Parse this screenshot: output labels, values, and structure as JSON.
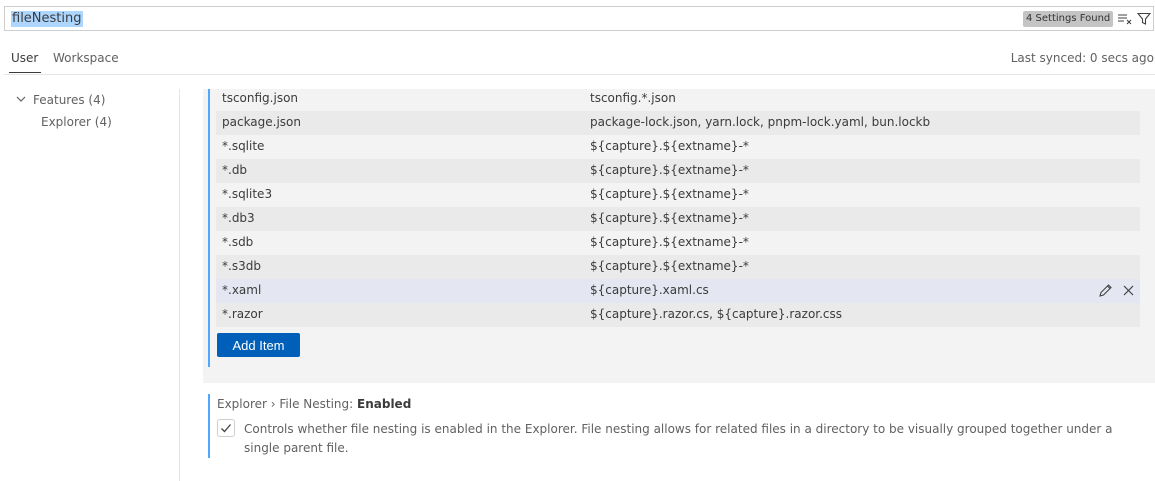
{
  "search": {
    "value": "fileNesting",
    "results_badge": "4 Settings Found"
  },
  "tabs": {
    "user": "User",
    "workspace": "Workspace",
    "last_synced": "Last synced: 0 secs ago"
  },
  "toc": {
    "features": "Features (4)",
    "explorer": "Explorer (4)"
  },
  "patterns": [
    {
      "key": "tsconfig.json",
      "value": "tsconfig.*.json"
    },
    {
      "key": "package.json",
      "value": "package-lock.json, yarn.lock, pnpm-lock.yaml, bun.lockb"
    },
    {
      "key": "*.sqlite",
      "value": "${capture}.${extname}-*"
    },
    {
      "key": "*.db",
      "value": "${capture}.${extname}-*"
    },
    {
      "key": "*.sqlite3",
      "value": "${capture}.${extname}-*"
    },
    {
      "key": "*.db3",
      "value": "${capture}.${extname}-*"
    },
    {
      "key": "*.sdb",
      "value": "${capture}.${extname}-*"
    },
    {
      "key": "*.s3db",
      "value": "${capture}.${extname}-*"
    },
    {
      "key": "*.xaml",
      "value": "${capture}.xaml.cs"
    },
    {
      "key": "*.razor",
      "value": "${capture}.razor.cs, ${capture}.razor.css"
    }
  ],
  "add_item_label": "Add Item",
  "enabled_setting": {
    "category": "Explorer › File Nesting: ",
    "name": "Enabled",
    "checked": true,
    "description": "Controls whether file nesting is enabled in the Explorer. File nesting allows for related files in a directory to be visually grouped together under a single parent file."
  }
}
